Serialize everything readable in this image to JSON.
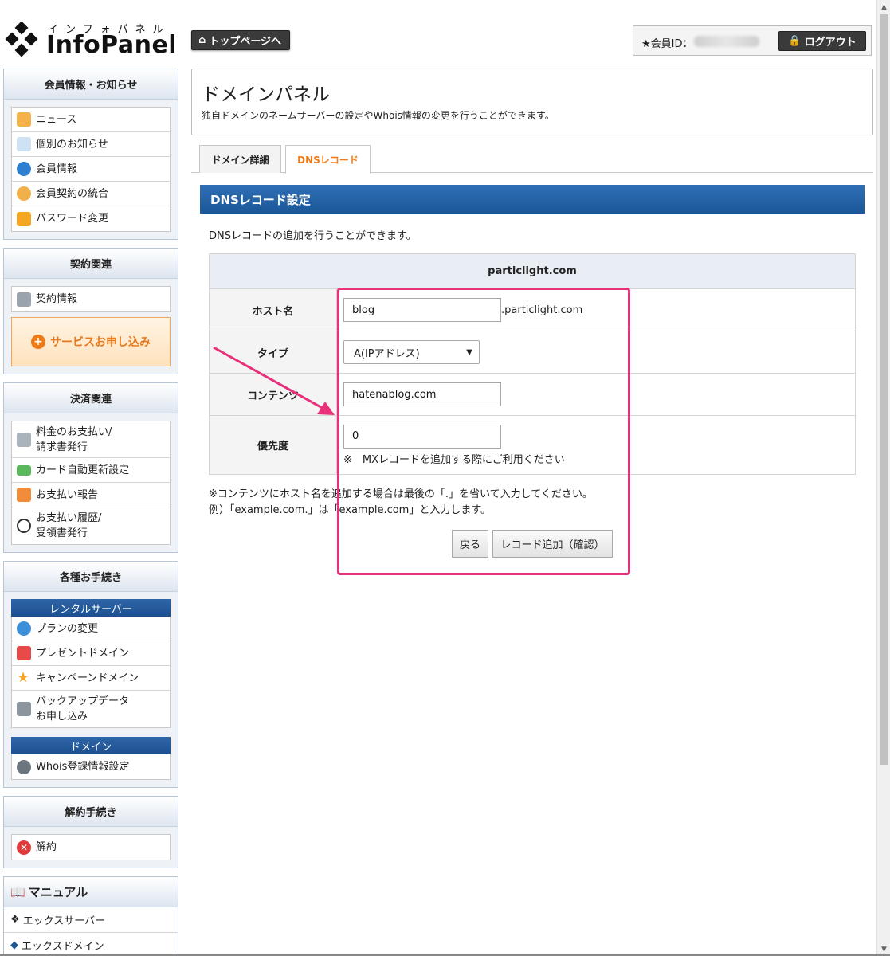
{
  "header": {
    "logo_kana": "インフォパネル",
    "logo_name": "InfoPanel",
    "top_page_label": "トップページへ",
    "member_id_label": "★会員ID：",
    "logout_label": "ログアウト"
  },
  "sidebar": {
    "member": {
      "title": "会員情報・お知らせ",
      "items": [
        "ニュース",
        "個別のお知らせ",
        "会員情報",
        "会員契約の統合",
        "パスワード変更"
      ]
    },
    "contract": {
      "title": "契約関連",
      "items": [
        "契約情報"
      ],
      "service_button": "サービスお申し込み"
    },
    "payment": {
      "title": "決済関連",
      "items": [
        "料金のお支払い/\n請求書発行",
        "カード自動更新設定",
        "お支払い報告",
        "お支払い履歴/\n受領書発行"
      ]
    },
    "procedures": {
      "title": "各種お手続き",
      "rental_server": "レンタルサーバー",
      "rental_items": [
        "プランの変更",
        "プレゼントドメイン",
        "キャンペーンドメイン",
        "バックアップデータ\nお申し込み"
      ],
      "domain": "ドメイン",
      "domain_items": [
        "Whois登録情報設定"
      ]
    },
    "cancel": {
      "title": "解約手続き",
      "items": [
        "解約"
      ]
    },
    "manual": {
      "title": "マニュアル",
      "items": [
        "エックスサーバー",
        "エックスドメイン"
      ]
    }
  },
  "main": {
    "title": "ドメインパネル",
    "description": "独自ドメインのネームサーバーの設定やWhois情報の変更を行うことができます。",
    "tabs": [
      {
        "label": "ドメイン詳細",
        "active": false
      },
      {
        "label": "DNSレコード",
        "active": true
      }
    ],
    "section_title": "DNSレコード設定",
    "section_desc": "DNSレコードの追加を行うことができます。",
    "domain": "particlight.com",
    "form": {
      "host_label": "ホスト名",
      "host_value": "blog",
      "host_suffix": ".particlight.com",
      "type_label": "タイプ",
      "type_value": "A(IPアドレス)",
      "content_label": "コンテンツ",
      "content_value": "hatenablog.com",
      "priority_label": "優先度",
      "priority_value": "0",
      "priority_note": "※　MXレコードを追加する際にご利用ください"
    },
    "footnote_1": "※コンテンツにホスト名を追加する場合は最後の「.」を省いて入力してください。",
    "footnote_2": "例）「example.com.」は「example.com」と入力します。",
    "back_button": "戻る",
    "add_button": "レコード追加（確認）"
  },
  "colors": {
    "accent_blue": "#1b5798",
    "tab_active": "#f07a16",
    "highlight": "#e8317a"
  }
}
